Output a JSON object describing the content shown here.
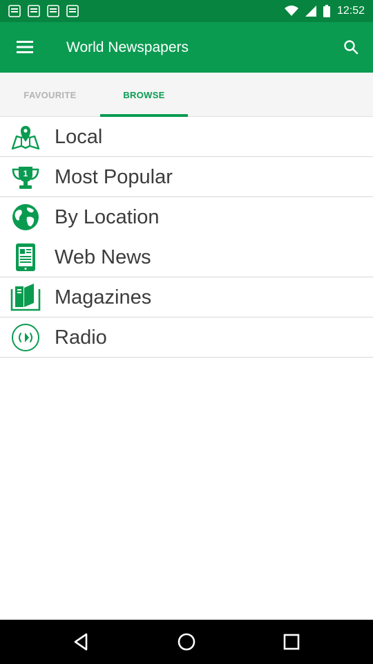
{
  "status_bar": {
    "time": "12:52",
    "icons": [
      "notification-icon",
      "notification-icon",
      "notification-icon",
      "notification-icon",
      "wifi-icon",
      "signal-icon",
      "battery-icon"
    ]
  },
  "app_bar": {
    "title": "World Newspapers",
    "menu_icon": "hamburger-menu-icon",
    "search_icon": "search-icon"
  },
  "tabs": [
    {
      "label": "FAVOURITE",
      "selected": false
    },
    {
      "label": "BROWSE",
      "selected": true
    }
  ],
  "list": {
    "items": [
      {
        "label": "Local",
        "icon": "map-pin-icon"
      },
      {
        "label": "Most Popular",
        "icon": "trophy-icon"
      },
      {
        "label": "By Location",
        "icon": "globe-icon"
      },
      {
        "label": "Web News",
        "icon": "phone-news-icon"
      },
      {
        "label": "Magazines",
        "icon": "magazines-icon"
      },
      {
        "label": "Radio",
        "icon": "radio-icon"
      }
    ]
  },
  "colors": {
    "status_bar": "#07843f",
    "app_bar": "#0a9b51",
    "accent": "#0a9b51",
    "icon_color": "#0a9b51"
  },
  "nav_bar": {
    "icons": [
      "back-icon",
      "home-icon",
      "recents-icon"
    ]
  }
}
